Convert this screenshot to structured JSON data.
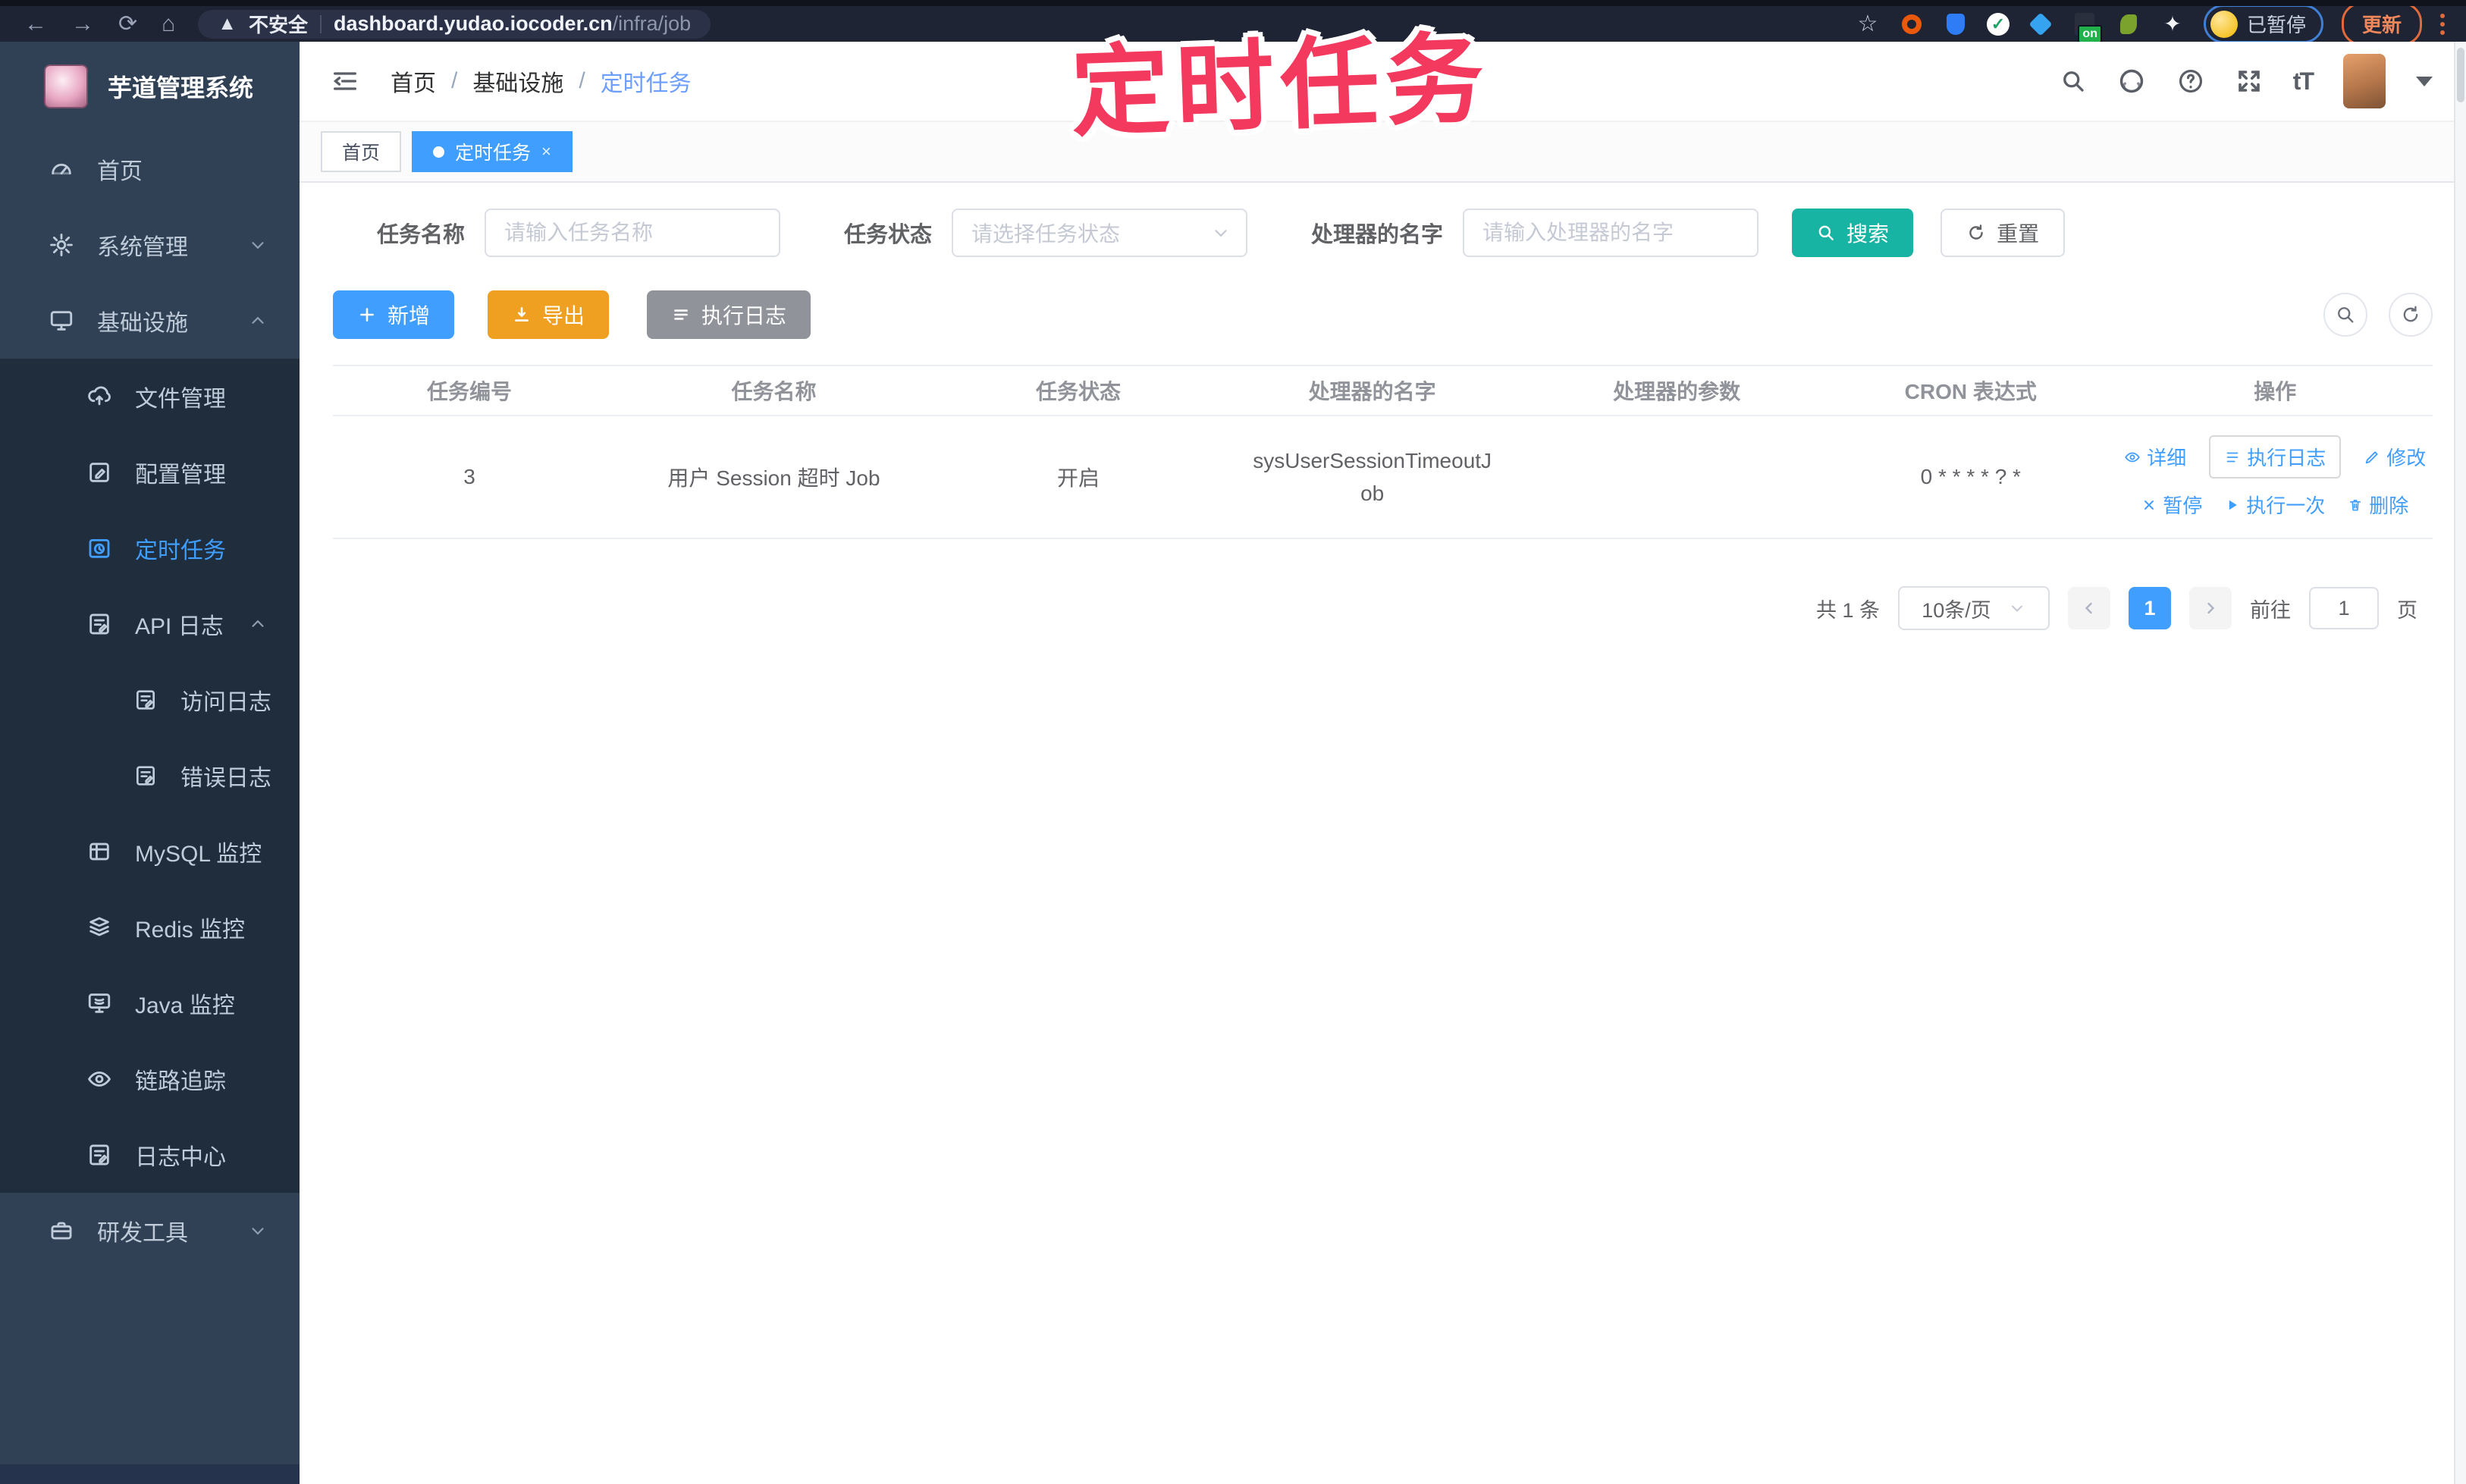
{
  "browser": {
    "secure": "不安全",
    "host": "dashboard.yudao.iocoder.cn",
    "path": "/infra/job",
    "ext_on": "on",
    "paused": "已暂停",
    "update": "更新"
  },
  "annotation": {
    "text": "定时任务",
    "color": "#f4395f"
  },
  "sidebar": {
    "title": "芋道管理系统",
    "items": [
      {
        "label": "首页"
      },
      {
        "label": "系统管理",
        "chevron": "down"
      },
      {
        "label": "基础设施",
        "chevron": "up"
      },
      {
        "label": "文件管理"
      },
      {
        "label": "配置管理"
      },
      {
        "label": "定时任务",
        "active": true
      },
      {
        "label": "API 日志",
        "chevron": "up"
      },
      {
        "label": "访问日志"
      },
      {
        "label": "错误日志"
      },
      {
        "label": "MySQL 监控"
      },
      {
        "label": "Redis 监控"
      },
      {
        "label": "Java 监控"
      },
      {
        "label": "链路追踪"
      },
      {
        "label": "日志中心"
      },
      {
        "label": "研发工具",
        "chevron": "down"
      }
    ]
  },
  "header": {
    "breadcrumb": [
      "首页",
      "基础设施",
      "定时任务"
    ],
    "separator": "/"
  },
  "tabs": [
    {
      "label": "首页",
      "active": false
    },
    {
      "label": "定时任务",
      "active": true,
      "close": "×"
    }
  ],
  "filters": {
    "name_label": "任务名称",
    "name_placeholder": "请输入任务名称",
    "status_label": "任务状态",
    "status_placeholder": "请选择任务状态",
    "handler_label": "处理器的名字",
    "handler_placeholder": "请输入处理器的名字",
    "search": "搜索",
    "reset": "重置"
  },
  "toolbar": {
    "add": "新增",
    "export": "导出",
    "exec_log": "执行日志"
  },
  "table": {
    "columns": [
      "任务编号",
      "任务名称",
      "任务状态",
      "处理器的名字",
      "处理器的参数",
      "CRON 表达式",
      "操作"
    ],
    "row": {
      "id": "3",
      "name": "用户 Session 超时 Job",
      "status": "开启",
      "handler": "sysUserSessionTimeoutJob",
      "param": "",
      "cron": "0 * * * * ? *"
    }
  },
  "actions": {
    "r1": [
      {
        "label": "详细",
        "icon": "eye"
      },
      {
        "label": "执行日志",
        "icon": "list"
      },
      {
        "label": "修改",
        "icon": "pencil"
      }
    ],
    "r2": [
      {
        "label": "暂停",
        "icon": "x"
      },
      {
        "label": "执行一次",
        "icon": "play"
      },
      {
        "label": "删除",
        "icon": "trash"
      }
    ]
  },
  "pagination": {
    "total": "共 1 条",
    "size": "10条/页",
    "page": "1",
    "goto": "前往",
    "goto_value": "1",
    "unit": "页"
  },
  "colors": {
    "accent": "#409eff",
    "search_teal": "#17b3a3",
    "export_orange": "#f0a020",
    "info_gray": "#909399",
    "sidebar_bg": "#304156",
    "submenu_bg": "#1f2d3d",
    "annotation_pink": "#f4395f"
  }
}
